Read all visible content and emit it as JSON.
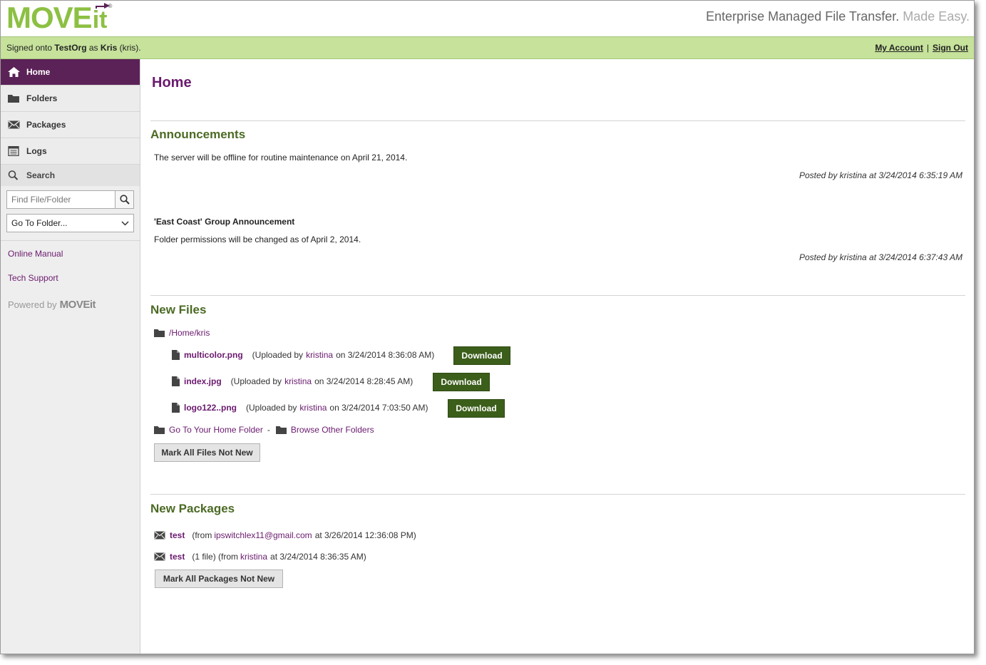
{
  "header": {
    "logo_text": "MOVEit",
    "logo_main": "MOVE",
    "logo_it": "it",
    "logo_reg": "®",
    "tagline_main": "Enterprise Managed File Transfer.",
    "tagline_easy": "Made Easy."
  },
  "statusbar": {
    "signed_prefix": "Signed onto",
    "org": "TestOrg",
    "as_text": "as",
    "user": "Kris",
    "username": "(kris).",
    "my_account": "My Account",
    "separator": "|",
    "sign_out": "Sign Out"
  },
  "sidebar": {
    "items": [
      {
        "label": "Home",
        "icon": "home-icon"
      },
      {
        "label": "Folders",
        "icon": "folder-icon"
      },
      {
        "label": "Packages",
        "icon": "envelope-icon"
      },
      {
        "label": "Logs",
        "icon": "log-icon"
      }
    ],
    "search_label": "Search",
    "search_placeholder": "Find File/Folder",
    "folder_select": "Go To Folder...",
    "online_manual": "Online Manual",
    "tech_support": "Tech Support",
    "powered_by": "Powered by",
    "powered_logo": "MOVEit"
  },
  "main": {
    "title": "Home",
    "announcements": {
      "heading": "Announcements",
      "items": [
        {
          "title": "",
          "text": "The server will be offline for routine maintenance on April 21, 2014.",
          "posted": "Posted by kristina at 3/24/2014 6:35:19 AM"
        },
        {
          "title": "'East Coast' Group Announcement",
          "text": "Folder permissions will be changed as of April 2, 2014.",
          "posted": "Posted by kristina at 3/24/2014 6:37:43 AM"
        }
      ]
    },
    "new_files": {
      "heading": "New Files",
      "folder": "/Home/kris",
      "files": [
        {
          "name": "multicolor.png",
          "uploaded_prefix": "(Uploaded by",
          "by": "kristina",
          "on": "on 3/24/2014 8:36:08 AM)",
          "button": "Download"
        },
        {
          "name": "index.jpg",
          "uploaded_prefix": "(Uploaded by",
          "by": "kristina",
          "on": "on 3/24/2014 8:28:45 AM)",
          "button": "Download"
        },
        {
          "name": "logo122..png",
          "uploaded_prefix": "(Uploaded by",
          "by": "kristina",
          "on": "on 3/24/2014 7:03:50 AM)",
          "button": "Download"
        }
      ],
      "go_home": "Go To Your Home Folder",
      "dash": "-",
      "browse_other": "Browse Other Folders",
      "mark_button": "Mark All Files Not New"
    },
    "new_packages": {
      "heading": "New Packages",
      "packages": [
        {
          "name": "test",
          "pre": "(from",
          "from": "ipswitchlex11@gmail.com",
          "post": "at 3/26/2014 12:36:08 PM)"
        },
        {
          "name": "test",
          "pre": "(1 file) (from",
          "from": "kristina",
          "post": "at 3/24/2014 8:36:35 AM)"
        }
      ],
      "mark_button": "Mark All Packages Not New"
    }
  },
  "colors": {
    "brand_green": "#8cc043",
    "status_bar": "#c6e29b",
    "nav_active": "#5b2257",
    "link_purple": "#6a1a6e",
    "section_green": "#4b6a24",
    "download_button": "#3c5e1b"
  }
}
